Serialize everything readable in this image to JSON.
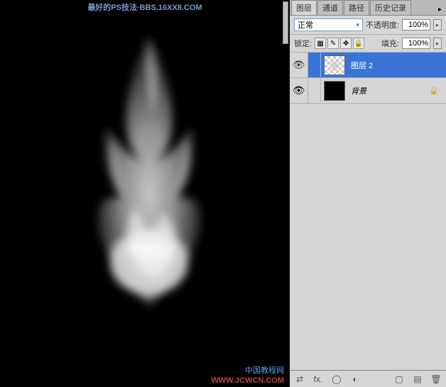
{
  "watermarks": {
    "top": "最好的PS技法·BBS.16XX8.COM",
    "bottom1": "中国教程网",
    "bottom2": "WWW.JCWCN.COM"
  },
  "tabs": {
    "layers": "图层",
    "channels": "通道",
    "paths": "路径",
    "history": "历史记录"
  },
  "blend": {
    "mode": "正常",
    "opacity_label": "不透明度:",
    "opacity": "100%"
  },
  "lock": {
    "label": "锁定:",
    "fill_label": "填充:",
    "fill": "100%"
  },
  "lock_icons": {
    "transparent": "▦",
    "pixels": "✎",
    "position": "✥",
    "all": "🔒"
  },
  "layers": [
    {
      "name": "图层 2",
      "visible": true,
      "selected": true,
      "thumb": "checker",
      "locked": false
    },
    {
      "name": "背景",
      "visible": true,
      "selected": false,
      "thumb": "black",
      "locked": true
    }
  ],
  "footer_icons": {
    "link": "⇄",
    "fx": "fx.",
    "mask": "◯",
    "adjust": "◐",
    "folder": "▢",
    "new": "▤",
    "trash": "🗑"
  }
}
